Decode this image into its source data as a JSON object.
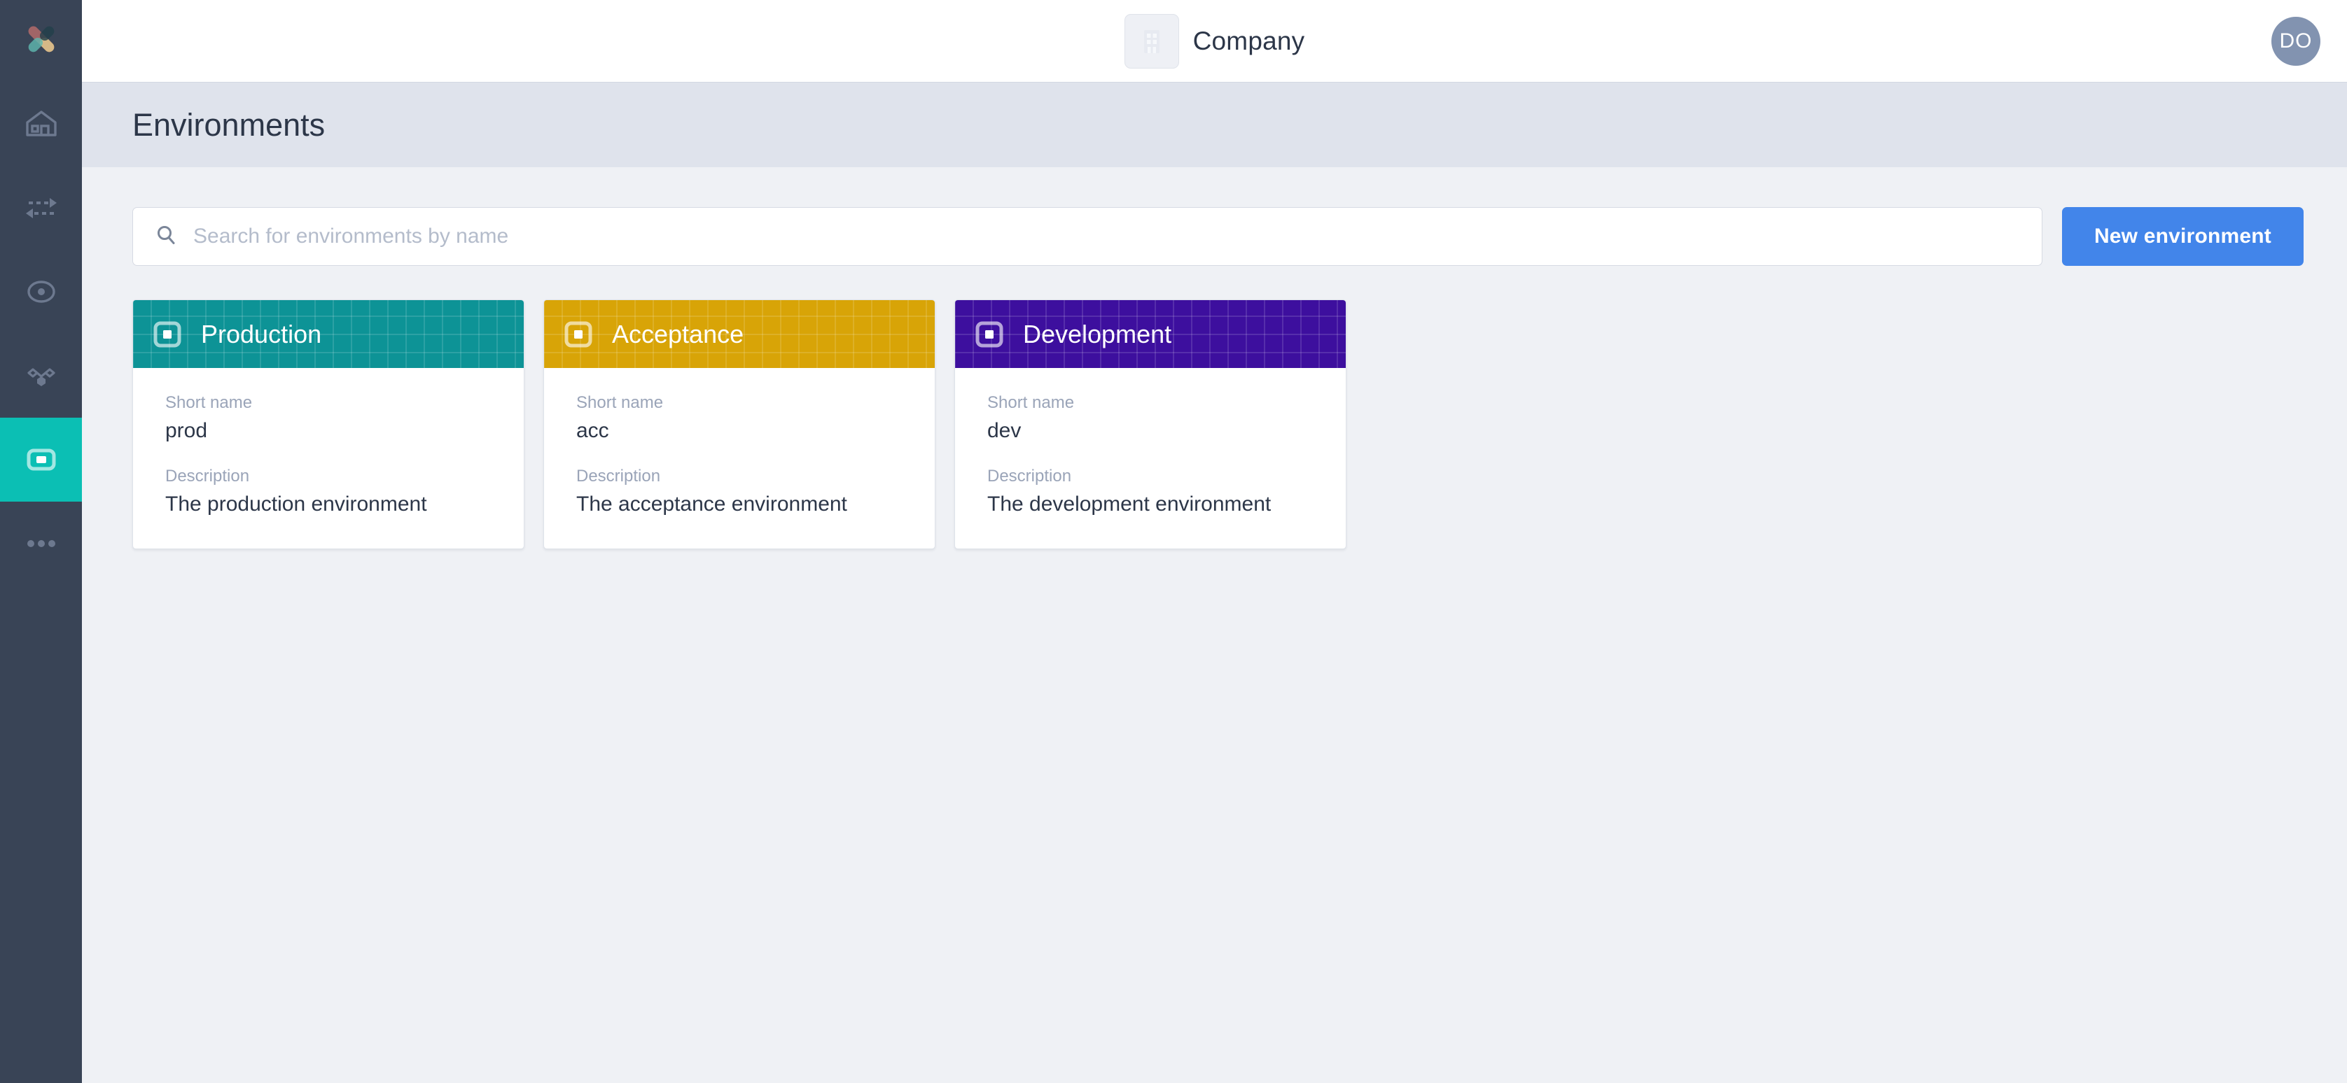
{
  "app": {
    "logo_icon": "x-logo-icon",
    "sidebar": {
      "items": [
        {
          "key": "home",
          "icon": "home-icon",
          "label": "Home",
          "active": false
        },
        {
          "key": "transfers",
          "icon": "transfer-arrows-icon",
          "label": "Transfers",
          "active": false
        },
        {
          "key": "target",
          "icon": "target-circle-icon",
          "label": "Target",
          "active": false
        },
        {
          "key": "network",
          "icon": "hexagon-network-icon",
          "label": "Network",
          "active": false
        },
        {
          "key": "environments",
          "icon": "environment-square-icon",
          "label": "Environments",
          "active": true
        },
        {
          "key": "more",
          "icon": "more-dots-icon",
          "label": "More",
          "active": false
        }
      ]
    }
  },
  "topbar": {
    "company_icon": "building-icon",
    "company_name": "Company",
    "avatar_initials": "DO"
  },
  "page": {
    "title": "Environments"
  },
  "search": {
    "icon": "search-icon",
    "placeholder": "Search for environments by name",
    "value": ""
  },
  "actions": {
    "new_environment_label": "New environment"
  },
  "labels": {
    "short_name": "Short name",
    "description": "Description"
  },
  "colors": {
    "accent_blue": "#4285ea",
    "sidebar_bg": "#394456",
    "sidebar_active": "#0bbfb4",
    "production": "#0d9396",
    "acceptance": "#d8a407",
    "development": "#3d0f9e"
  },
  "environments": [
    {
      "name": "Production",
      "icon": "environment-square-icon",
      "header_color": "#0d9396",
      "short_name": "prod",
      "description": "The production environment"
    },
    {
      "name": "Acceptance",
      "icon": "environment-square-icon",
      "header_color": "#d8a407",
      "short_name": "acc",
      "description": "The acceptance environment"
    },
    {
      "name": "Development",
      "icon": "environment-square-icon",
      "header_color": "#3d0f9e",
      "short_name": "dev",
      "description": "The development environment"
    }
  ]
}
